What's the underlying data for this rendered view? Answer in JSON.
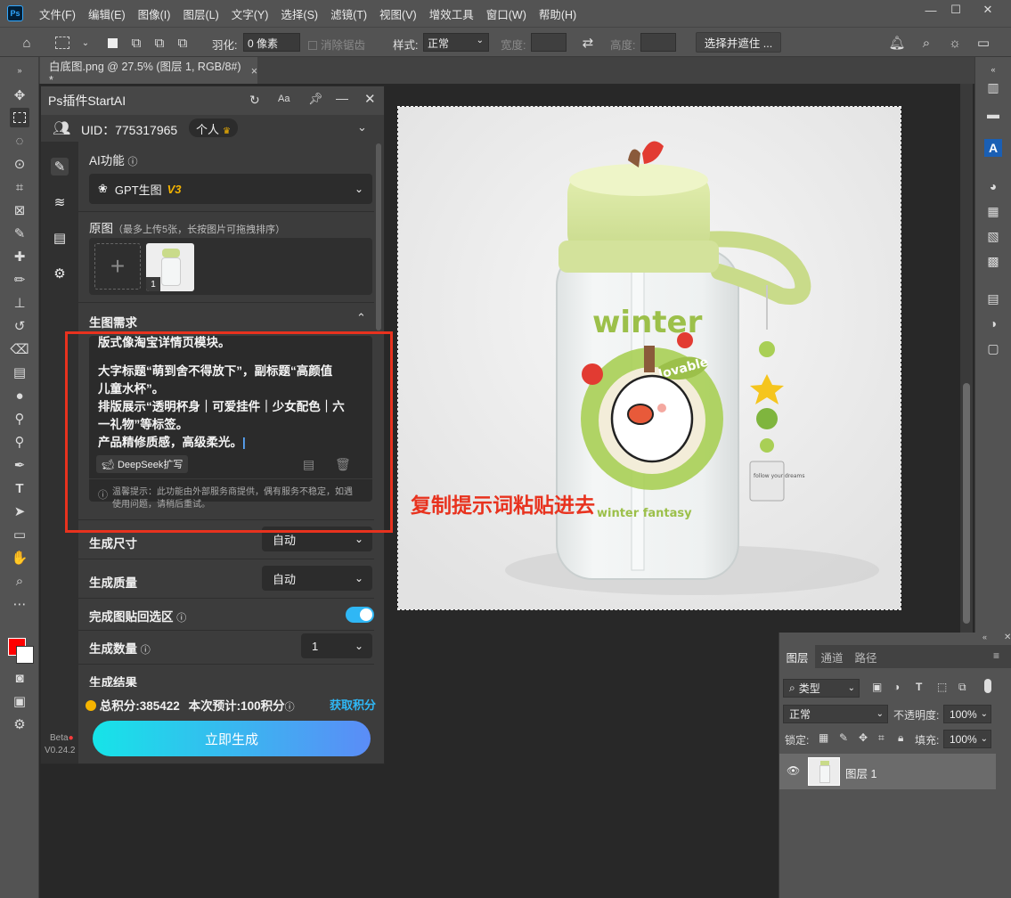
{
  "app": {
    "logo": "Ps"
  },
  "menu": [
    "文件(F)",
    "编辑(E)",
    "图像(I)",
    "图层(L)",
    "文字(Y)",
    "选择(S)",
    "滤镜(T)",
    "视图(V)",
    "增效工具",
    "窗口(W)",
    "帮助(H)"
  ],
  "options": {
    "feather_label": "羽化:",
    "feather_value": "0 像素",
    "antialias_label": "消除锯齿",
    "style_label": "样式:",
    "style_value": "正常",
    "width_label": "宽度:",
    "height_label": "高度:",
    "select_mask_button": "选择并遮住 ..."
  },
  "document_tab": {
    "title": "白底图.png @ 27.5% (图层 1, RGB/8#) *",
    "close": "×"
  },
  "plugin": {
    "title": "Ps插件StartAI",
    "uid_label": "UID：775317965",
    "account_badge": "个人",
    "ai_function_label": "AI功能",
    "ai_model": "GPT生图",
    "ai_model_version": "V3",
    "source_label": "原图",
    "source_hint": "（最多上传5张，长按图片可拖拽排序）",
    "thumb_count": "1",
    "prompt_section_label": "生图需求",
    "prompt_lines": [
      "版式像淘宝详情页模块。",
      "大字标题“萌到舍不得放下”，副标题“高颜值",
      "儿童水杯”。",
      "排版展示“透明杯身｜可爱挂件｜少女配色｜六",
      "一礼物”等标签。",
      "产品精修质感，高级柔光。"
    ],
    "deepseek_button": "DeepSeek扩写",
    "notice": "温馨提示：此功能由外部服务商提供，偶有服务不稳定，如遇",
    "notice_line2": "使用问题，请稍后重试。",
    "size_label": "生成尺寸",
    "size_value": "自动",
    "quality_label": "生成质量",
    "quality_value": "自动",
    "paste_back_label": "完成图贴回选区",
    "count_label": "生成数量",
    "count_value": "1",
    "result_label_partial": "生成结果",
    "points_total": "总积分:385422",
    "points_estimate": "本次预计:100积分",
    "get_points_link": "获取积分",
    "generate_button": "立即生成",
    "beta_label": "Beta",
    "version_label": "V0.24.2"
  },
  "layers_panel": {
    "tabs": [
      "图层",
      "通道",
      "路径"
    ],
    "filter_label": "类型",
    "blend_mode": "正常",
    "opacity_label": "不透明度:",
    "opacity_value": "100%",
    "lock_label": "锁定:",
    "fill_label": "填充:",
    "fill_value": "100%",
    "layer_name": "图层 1"
  },
  "product": {
    "title_text": "winter",
    "badge_text": "lovable",
    "tag_text": "follow your dreams",
    "bottom_text": "winter fantasy"
  },
  "annotation": {
    "callout": "复制提示词粘贴进去",
    "color": "#e8321e"
  },
  "colors": {
    "accent": "#2fb7f5",
    "highlight": "#e8321e",
    "foreground": "#ff0000",
    "gold": "#f5b400"
  }
}
